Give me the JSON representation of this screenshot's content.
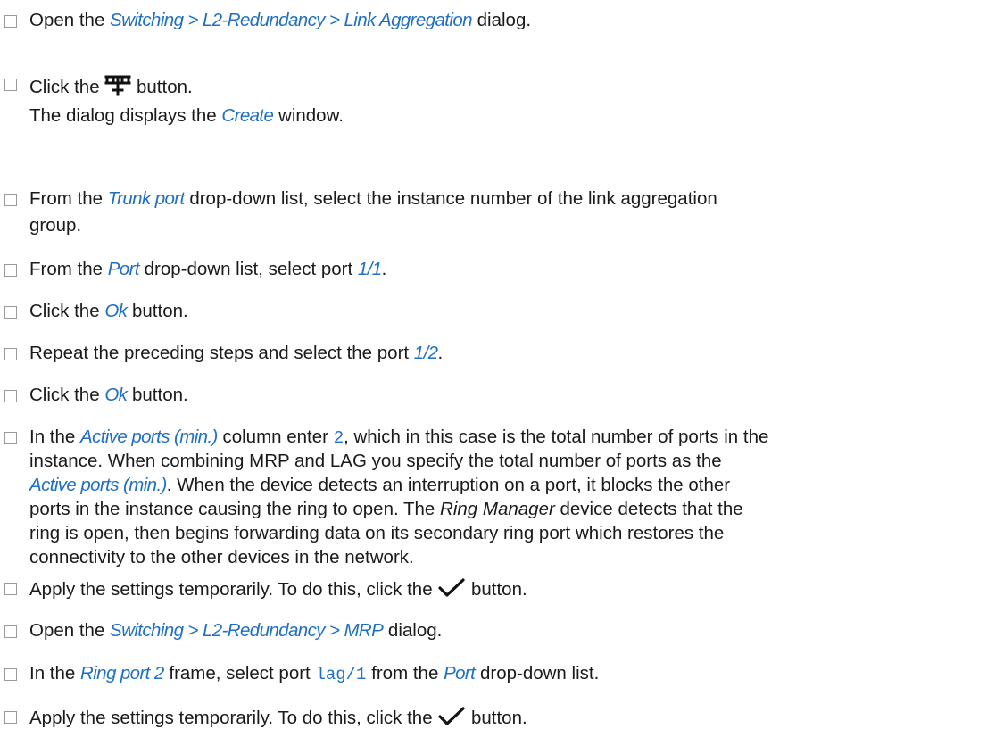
{
  "steps": [
    {
      "lines": [
        [
          {
            "t": "Open the "
          },
          {
            "t": "Switching > L2-Redundancy > Link Aggregation",
            "s": "gui"
          },
          {
            "t": " dialog."
          }
        ]
      ]
    },
    {
      "lines": [
        [
          {
            "t": "Click the "
          },
          {
            "icon": "add-link-aggregation-icon"
          },
          {
            "t": " button."
          }
        ],
        [
          {
            "t": "The dialog displays the "
          },
          {
            "t": "Create",
            "s": "gui"
          },
          {
            "t": " window."
          }
        ]
      ]
    },
    {
      "lines": [
        [
          {
            "t": "From the "
          },
          {
            "t": "Trunk port",
            "s": "gui"
          },
          {
            "t": " drop-down list, select the instance number of the link aggregation"
          }
        ],
        [
          {
            "t": "group."
          }
        ]
      ]
    },
    {
      "lines": [
        [
          {
            "t": "From the "
          },
          {
            "t": "Port",
            "s": "gui"
          },
          {
            "t": " drop-down list, select port "
          },
          {
            "t": "1/1",
            "s": "gui"
          },
          {
            "t": "."
          }
        ]
      ]
    },
    {
      "lines": [
        [
          {
            "t": "Click the "
          },
          {
            "t": "Ok",
            "s": "gui"
          },
          {
            "t": " button."
          }
        ]
      ]
    },
    {
      "lines": [
        [
          {
            "t": "Repeat the preceding steps and select the port "
          },
          {
            "t": "1/2",
            "s": "gui"
          },
          {
            "t": "."
          }
        ]
      ]
    },
    {
      "lines": [
        [
          {
            "t": "Click the "
          },
          {
            "t": "Ok",
            "s": "gui"
          },
          {
            "t": " button."
          }
        ]
      ]
    },
    {
      "lines": [
        [
          {
            "t": "In the "
          },
          {
            "t": "Active ports (min.)",
            "s": "gui"
          },
          {
            "t": " column enter "
          },
          {
            "t": "2",
            "s": "mono"
          },
          {
            "t": ", which in this case is the total number of ports in the"
          }
        ],
        [
          {
            "t": "instance. When combining MRP and LAG you specify the total number of ports as the"
          }
        ],
        [
          {
            "t": "Active ports (min.)",
            "s": "gui"
          },
          {
            "t": ". When the device detects an interruption on a port, it blocks the other"
          }
        ],
        [
          {
            "t": "ports in the instance causing the ring to open. The "
          },
          {
            "t": "Ring Manager",
            "s": "emph"
          },
          {
            "t": " device detects that the"
          }
        ],
        [
          {
            "t": "ring is open, then begins forwarding data on its secondary ring port which restores the"
          }
        ],
        [
          {
            "t": "connectivity to the other devices in the network."
          }
        ]
      ]
    },
    {
      "lines": [
        [
          {
            "t": "Apply the settings temporarily. To do this, click the "
          },
          {
            "icon": "checkmark-icon"
          },
          {
            "t": " button."
          }
        ]
      ]
    },
    {
      "lines": [
        [
          {
            "t": "Open the "
          },
          {
            "t": "Switching > L2-Redundancy > MRP",
            "s": "gui"
          },
          {
            "t": " dialog."
          }
        ]
      ]
    },
    {
      "lines": [
        [
          {
            "t": "In the "
          },
          {
            "t": "Ring port 2",
            "s": "gui"
          },
          {
            "t": " frame, select port "
          },
          {
            "t": "lag/1",
            "s": "mono"
          },
          {
            "t": " from the "
          },
          {
            "t": "Port",
            "s": "gui"
          },
          {
            "t": " drop-down list."
          }
        ]
      ]
    },
    {
      "lines": [
        [
          {
            "t": "Apply the settings temporarily. To do this, click the "
          },
          {
            "icon": "checkmark-icon"
          },
          {
            "t": " button."
          }
        ]
      ]
    }
  ]
}
